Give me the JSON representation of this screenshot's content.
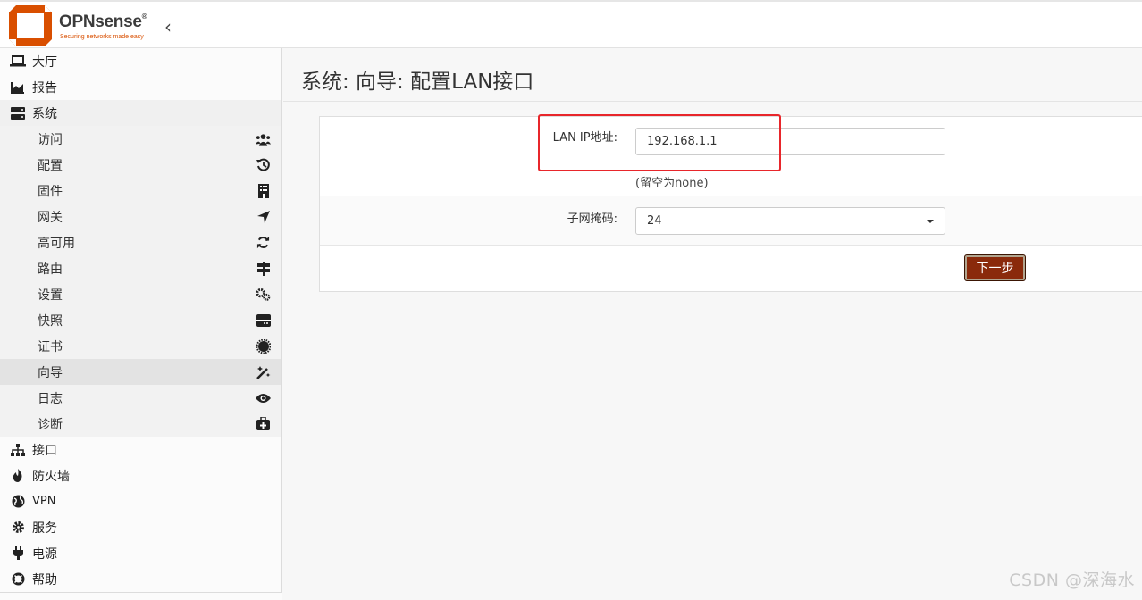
{
  "brand": {
    "name": "OPNsense",
    "registered": "®",
    "tagline": "Securing networks made easy",
    "collapse_glyph": "‹"
  },
  "colors": {
    "brand_orange": "#d94f00",
    "button_bg": "#8a2a0b",
    "highlight_box": "#e8262b"
  },
  "sidebar": {
    "top_items": [
      {
        "label": "大厅",
        "icon": "laptop-icon"
      },
      {
        "label": "报告",
        "icon": "area-chart-icon"
      },
      {
        "label": "系统",
        "icon": "server-icon"
      }
    ],
    "system_items": [
      {
        "label": "访问",
        "icon": "users-icon"
      },
      {
        "label": "配置",
        "icon": "history-icon"
      },
      {
        "label": "固件",
        "icon": "building-icon"
      },
      {
        "label": "网关",
        "icon": "location-arrow-icon"
      },
      {
        "label": "高可用",
        "icon": "refresh-icon"
      },
      {
        "label": "路由",
        "icon": "map-signs-icon"
      },
      {
        "label": "设置",
        "icon": "cogs-icon"
      },
      {
        "label": "快照",
        "icon": "hdd-icon"
      },
      {
        "label": "证书",
        "icon": "certificate-icon"
      },
      {
        "label": "向导",
        "icon": "magic-icon",
        "active": true
      },
      {
        "label": "日志",
        "icon": "eye-icon"
      },
      {
        "label": "诊断",
        "icon": "medkit-icon"
      }
    ],
    "bottom_items": [
      {
        "label": "接口",
        "icon": "sitemap-icon"
      },
      {
        "label": "防火墙",
        "icon": "fire-icon"
      },
      {
        "label": "VPN",
        "icon": "globe-icon"
      },
      {
        "label": "服务",
        "icon": "cog-icon"
      },
      {
        "label": "电源",
        "icon": "plug-icon"
      },
      {
        "label": "帮助",
        "icon": "life-ring-icon"
      }
    ]
  },
  "main": {
    "title": "系统: 向导: 配置LAN接口",
    "form": {
      "ip_label": "LAN IP地址:",
      "ip_value": "192.168.1.1",
      "ip_hint": "(留空为none)",
      "subnet_label": "子网掩码:",
      "subnet_value": "24",
      "next_button": "下一步"
    }
  },
  "watermark": "CSDN @深海水"
}
